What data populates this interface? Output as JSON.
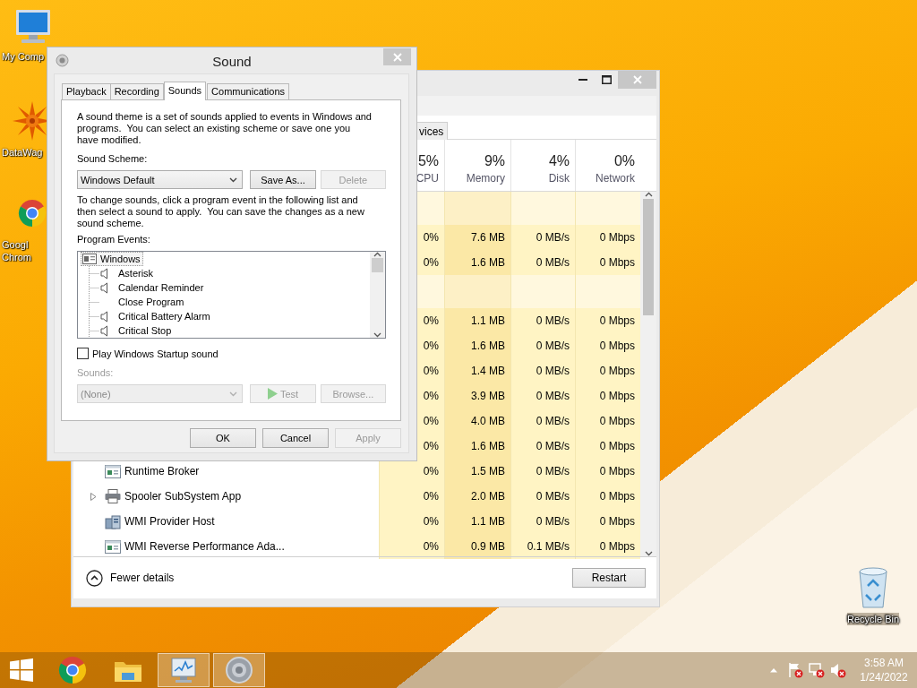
{
  "desktop_icons": [
    {
      "kind": "computer",
      "label": "My Comp"
    },
    {
      "kind": "sun",
      "label": "DataWag"
    },
    {
      "kind": "chrome",
      "label": "Googl Chrom"
    },
    {
      "kind": "recycle",
      "label": "Recycle Bin"
    }
  ],
  "task_manager": {
    "tabs": [
      {
        "label": "vices",
        "selected": false
      }
    ],
    "columns": [
      {
        "percent": "5%",
        "label": "CPU"
      },
      {
        "percent": "9%",
        "label": "Memory"
      },
      {
        "percent": "4%",
        "label": "Disk"
      },
      {
        "percent": "0%",
        "label": "Network"
      }
    ],
    "rows": [
      {
        "kind": "group"
      },
      {
        "kind": "process",
        "values": [
          "0%",
          "7.6 MB",
          "0 MB/s",
          "0 Mbps"
        ]
      },
      {
        "kind": "process",
        "values": [
          "0%",
          "1.6 MB",
          "0 MB/s",
          "0 Mbps"
        ]
      },
      {
        "kind": "group"
      },
      {
        "kind": "process",
        "values": [
          "0%",
          "1.1 MB",
          "0 MB/s",
          "0 Mbps"
        ]
      },
      {
        "kind": "process",
        "values": [
          "0%",
          "1.6 MB",
          "0 MB/s",
          "0 Mbps"
        ]
      },
      {
        "kind": "process",
        "values": [
          "0%",
          "1.4 MB",
          "0 MB/s",
          "0 Mbps"
        ]
      },
      {
        "kind": "process",
        "values": [
          "0%",
          "3.9 MB",
          "0 MB/s",
          "0 Mbps"
        ]
      },
      {
        "kind": "process",
        "values": [
          "0%",
          "4.0 MB",
          "0 MB/s",
          "0 Mbps"
        ]
      },
      {
        "kind": "process",
        "values": [
          "0%",
          "1.6 MB",
          "0 MB/s",
          "0 Mbps"
        ]
      },
      {
        "kind": "app",
        "name": "Runtime Broker",
        "expandable": false,
        "values": [
          "0%",
          "1.5 MB",
          "0 MB/s",
          "0 Mbps"
        ]
      },
      {
        "kind": "printer",
        "name": "Spooler SubSystem App",
        "expandable": true,
        "values": [
          "0%",
          "2.0 MB",
          "0 MB/s",
          "0 Mbps"
        ]
      },
      {
        "kind": "wmi",
        "name": "WMI Provider Host",
        "expandable": false,
        "values": [
          "0%",
          "1.1 MB",
          "0 MB/s",
          "0 Mbps"
        ]
      },
      {
        "kind": "app",
        "name": "WMI Reverse Performance Ada...",
        "expandable": false,
        "values": [
          "0%",
          "0.9 MB",
          "0.1 MB/s",
          "0 Mbps"
        ]
      }
    ],
    "footer": {
      "toggle": "Fewer details",
      "button": "Restart"
    }
  },
  "sound_dialog": {
    "title": "Sound",
    "tabs": [
      {
        "label": "Playback",
        "selected": false
      },
      {
        "label": "Recording",
        "selected": false
      },
      {
        "label": "Sounds",
        "selected": true
      },
      {
        "label": "Communications",
        "selected": false
      }
    ],
    "intro": "A sound theme is a set of sounds applied to events in Windows and programs.  You can select an existing scheme or save one you have modified.",
    "scheme_label": "Sound Scheme:",
    "scheme": {
      "value": "Windows Default",
      "disabled": false
    },
    "scheme_buttons": [
      {
        "label": "Save As...",
        "disabled": false
      },
      {
        "label": "Delete",
        "disabled": true
      }
    ],
    "hint": "To change sounds, click a program event in the following list and then select a sound to apply.  You can save the changes as a new sound scheme.",
    "events_label": "Program Events:",
    "events": [
      {
        "label": "Windows",
        "selected": true,
        "children": [
          {
            "label": "Asterisk",
            "has_sound": true,
            "selected": false
          },
          {
            "label": "Calendar Reminder",
            "has_sound": true,
            "selected": false
          },
          {
            "label": "Close Program",
            "has_sound": false,
            "selected": false
          },
          {
            "label": "Critical Battery Alarm",
            "has_sound": true,
            "selected": false
          },
          {
            "label": "Critical Stop",
            "has_sound": true,
            "selected": false
          }
        ]
      }
    ],
    "startup_sound": {
      "label": "Play Windows Startup sound",
      "checked": false
    },
    "sounds_label": {
      "text": "Sounds:",
      "disabled": true
    },
    "sound": {
      "value": "(None)",
      "disabled": true
    },
    "sound_buttons": [
      {
        "label": "Test",
        "kind": "play",
        "disabled": true
      },
      {
        "label": "Browse...",
        "kind": "plain",
        "disabled": true
      }
    ],
    "buttons": [
      {
        "label": "OK",
        "disabled": false
      },
      {
        "label": "Cancel",
        "disabled": false
      },
      {
        "label": "Apply",
        "disabled": true
      }
    ]
  },
  "taskbar": {
    "apps": [
      {
        "kind": "start"
      },
      {
        "kind": "chrome",
        "active": false
      },
      {
        "kind": "explorer",
        "active": false
      },
      {
        "kind": "taskmgr",
        "active": true
      },
      {
        "kind": "sound",
        "active": true
      }
    ],
    "clock": {
      "time": "3:58 AM",
      "date": "1/24/2022"
    }
  }
}
